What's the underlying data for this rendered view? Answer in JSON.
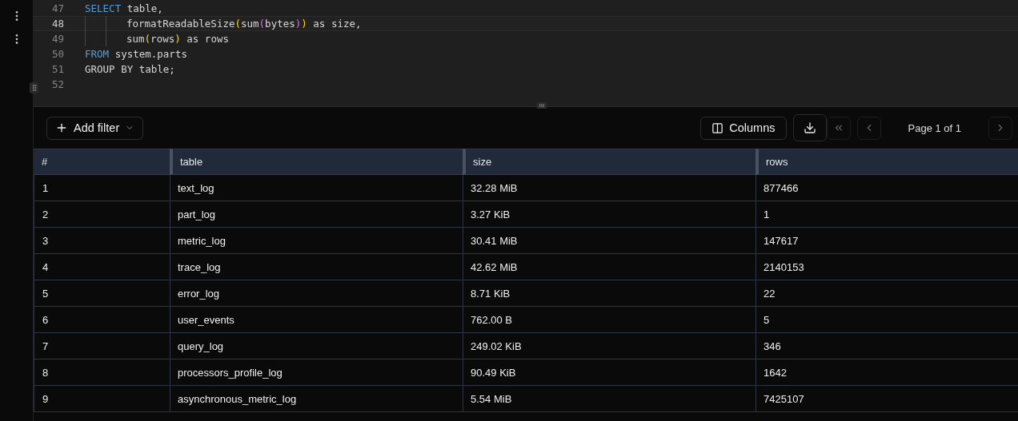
{
  "editor": {
    "lines": [
      {
        "number": "47",
        "current": false,
        "kind": "statement",
        "tokens": [
          {
            "text": "SELECT",
            "kind": "keyword"
          },
          {
            "text": " table,",
            "kind": "plain"
          }
        ]
      },
      {
        "number": "48",
        "current": true,
        "kind": "continuation",
        "tokens": [
          {
            "text": "formatReadableSize",
            "kind": "plain"
          },
          {
            "text": "(",
            "kind": "bracket1"
          },
          {
            "text": "sum",
            "kind": "plain"
          },
          {
            "text": "(",
            "kind": "bracket2"
          },
          {
            "text": "bytes",
            "kind": "plain"
          },
          {
            "text": ")",
            "kind": "bracket2"
          },
          {
            "text": ")",
            "kind": "bracket1"
          },
          {
            "text": " as size,",
            "kind": "plain"
          }
        ]
      },
      {
        "number": "49",
        "current": false,
        "kind": "continuation",
        "tokens": [
          {
            "text": "sum",
            "kind": "plain"
          },
          {
            "text": "(",
            "kind": "bracket1"
          },
          {
            "text": "rows",
            "kind": "plain"
          },
          {
            "text": ")",
            "kind": "bracket1"
          },
          {
            "text": " as rows",
            "kind": "plain"
          }
        ]
      },
      {
        "number": "50",
        "current": false,
        "kind": "statement",
        "tokens": [
          {
            "text": "FROM",
            "kind": "keyword"
          },
          {
            "text": " system.parts",
            "kind": "plain"
          }
        ]
      },
      {
        "number": "51",
        "current": false,
        "kind": "statement",
        "tokens": [
          {
            "text": "GROUP BY table;",
            "kind": "plain"
          }
        ]
      },
      {
        "number": "52",
        "current": false,
        "kind": "statement"
      }
    ]
  },
  "toolbar": {
    "add_filter": "Add filter",
    "columns": "Columns",
    "page_label": "Page 1 of 1"
  },
  "table": {
    "columns": [
      "#",
      "table",
      "size",
      "rows"
    ],
    "rows": [
      [
        "1",
        "text_log",
        "32.28 MiB",
        "877466"
      ],
      [
        "2",
        "part_log",
        "3.27 KiB",
        "1"
      ],
      [
        "3",
        "metric_log",
        "30.41 MiB",
        "147617"
      ],
      [
        "4",
        "trace_log",
        "42.62 MiB",
        "2140153"
      ],
      [
        "5",
        "error_log",
        "8.71 KiB",
        "22"
      ],
      [
        "6",
        "user_events",
        "762.00 B",
        "5"
      ],
      [
        "7",
        "query_log",
        "249.02 KiB",
        "346"
      ],
      [
        "8",
        "processors_profile_log",
        "90.49 KiB",
        "1642"
      ],
      [
        "9",
        "asynchronous_metric_log",
        "5.54 MiB",
        "7425107"
      ]
    ]
  }
}
